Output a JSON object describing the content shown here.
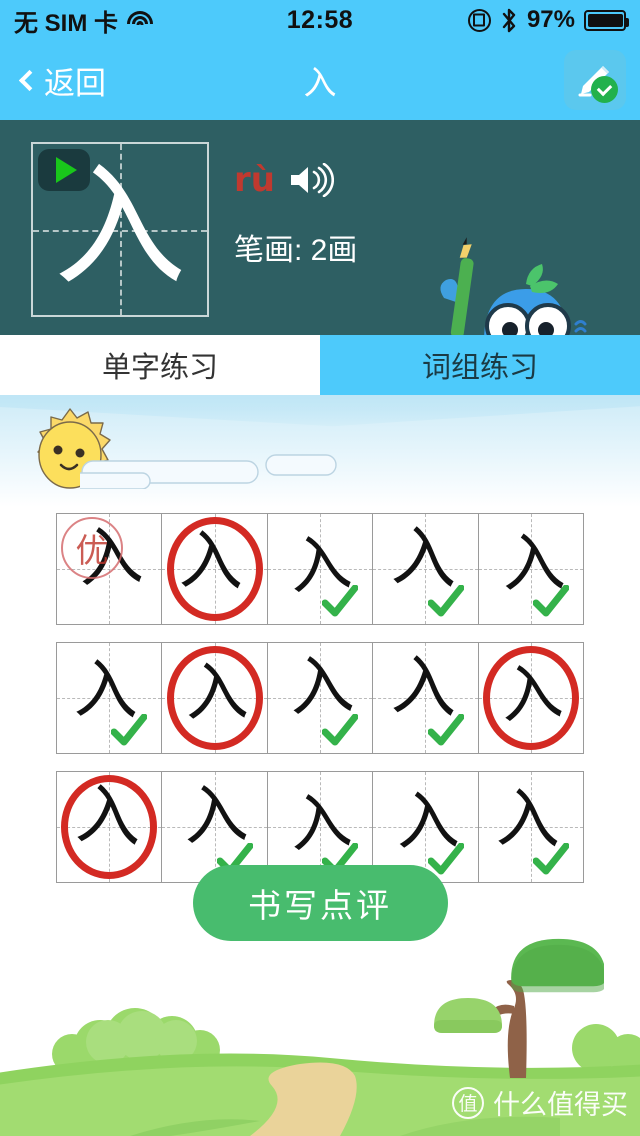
{
  "statusbar": {
    "carrier": "无 SIM 卡",
    "wifi_icon": "wifi-icon",
    "time": "12:58",
    "rotation_lock_icon": "rotation-lock-icon",
    "bluetooth_icon": "bluetooth-icon",
    "battery_percent": "97%",
    "battery_level": 97
  },
  "navbar": {
    "back_label": "返回",
    "back_icon": "chevron-left-icon",
    "title": "入",
    "edit_icon": "pen-edit-icon",
    "edit_badge_icon": "check-badge-icon"
  },
  "char_panel": {
    "character": "入",
    "play_icon": "play-icon",
    "pinyin": "rù",
    "speaker_icon": "speaker-icon",
    "stroke_label": "笔画: 2画",
    "mascot_icon": "bird-mascot-icon",
    "panel_color": "#2E5F63"
  },
  "tabs": [
    {
      "label": "单字练习",
      "active": false
    },
    {
      "label": "词组练习",
      "active": true
    }
  ],
  "scene": {
    "sun_icon": "sun-icon",
    "cloud_icon": "cloud-icon",
    "tree_icon": "tree-icon"
  },
  "practice": {
    "stamp_label": "优",
    "circle_color": "#D32A23",
    "check_color": "#34B24A",
    "rows": [
      {
        "cells": [
          {
            "char": "入",
            "mark": "stamp",
            "variant": "v1"
          },
          {
            "char": "入",
            "mark": "circle",
            "variant": "v2"
          },
          {
            "char": "入",
            "mark": "check",
            "variant": "v3"
          },
          {
            "char": "入",
            "mark": "check",
            "variant": "v4"
          },
          {
            "char": "入",
            "mark": "check",
            "variant": "v5"
          }
        ]
      },
      {
        "cells": [
          {
            "char": "入",
            "mark": "check",
            "variant": "v2"
          },
          {
            "char": "入",
            "mark": "circle",
            "variant": "v5"
          },
          {
            "char": "入",
            "mark": "check",
            "variant": "v1"
          },
          {
            "char": "入",
            "mark": "check",
            "variant": "v4"
          },
          {
            "char": "入",
            "mark": "circle",
            "variant": "v3"
          }
        ]
      },
      {
        "cells": [
          {
            "char": "入",
            "mark": "circle",
            "variant": "v4"
          },
          {
            "char": "入",
            "mark": "check",
            "variant": "v1"
          },
          {
            "char": "入",
            "mark": "check",
            "variant": "v3"
          },
          {
            "char": "入",
            "mark": "check",
            "variant": "v5"
          },
          {
            "char": "入",
            "mark": "check",
            "variant": "v2"
          }
        ]
      }
    ]
  },
  "review": {
    "label": "书写点评",
    "color": "#48BC6E"
  },
  "watermark": {
    "badge": "值",
    "text": "什么值得买"
  },
  "colors": {
    "header_blue": "#4DCAFB",
    "panel_teal": "#2E5F63",
    "accent_red": "#C0392F",
    "green": "#48BC6E"
  }
}
